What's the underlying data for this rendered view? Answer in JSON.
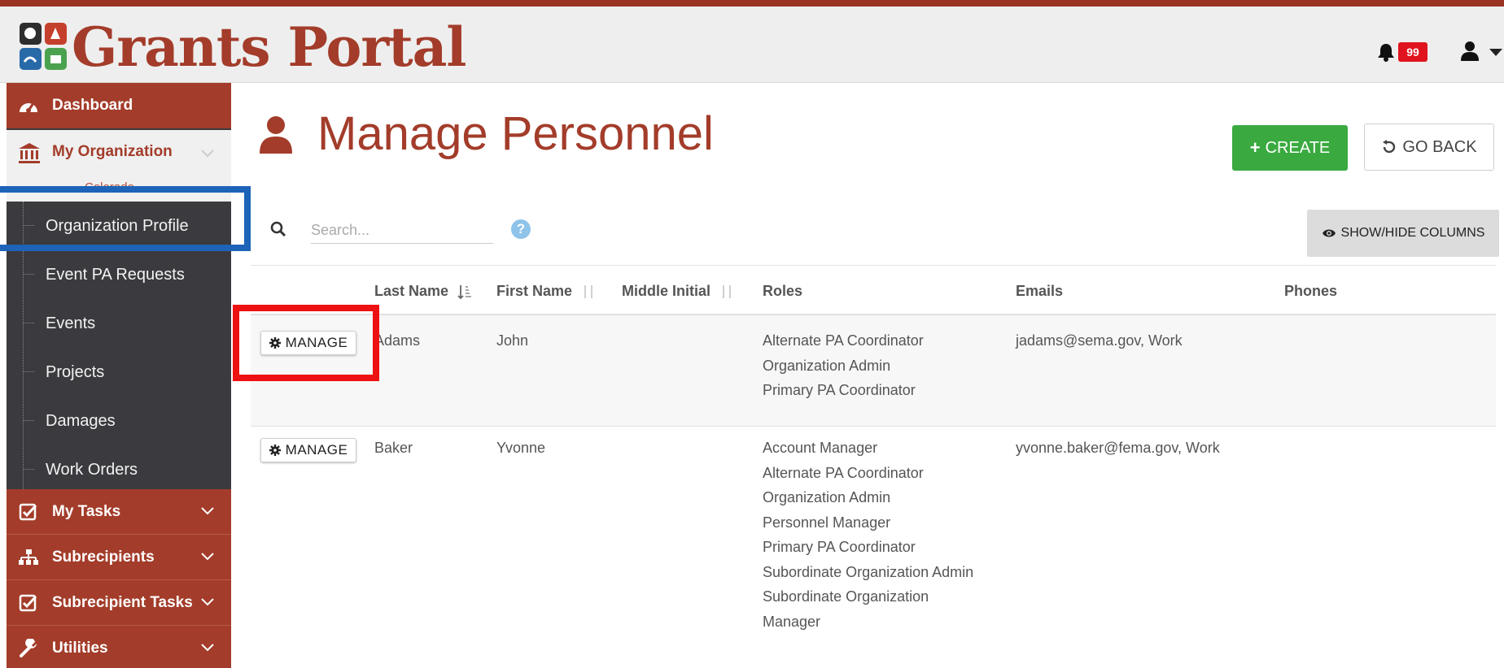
{
  "app": {
    "title": "Grants Portal",
    "notification_count": "99",
    "colors": {
      "brand": "#a33c2a",
      "sidebar_dark": "#3b3a3e",
      "create_green": "#3aaa40",
      "badge_red": "#e0141e"
    }
  },
  "sidebar": {
    "dashboard": "Dashboard",
    "my_organization": "My Organization",
    "organization_name": "Colorado",
    "sub_items": [
      "Organization Profile",
      "Event PA Requests",
      "Events",
      "Projects",
      "Damages",
      "Work Orders"
    ],
    "my_tasks": "My Tasks",
    "subrecipients": "Subrecipients",
    "subrecipient_tasks": "Subrecipient Tasks",
    "utilities": "Utilities"
  },
  "main": {
    "title": "Manage Personnel",
    "create_label": "CREATE",
    "back_label": "GO BACK",
    "search_placeholder": "Search...",
    "help_symbol": "?",
    "columns_label": "SHOW/HIDE COLUMNS",
    "headers": [
      "Last Name",
      "First Name",
      "Middle Initial",
      "Roles",
      "Emails",
      "Phones"
    ],
    "manage_label": "MANAGE",
    "rows": [
      {
        "last": "Adams",
        "first": "John",
        "middle": "",
        "roles": [
          "Alternate PA Coordinator",
          "Organization Admin",
          "Primary PA Coordinator"
        ],
        "email": "jadams@sema.gov, Work",
        "phone": ""
      },
      {
        "last": "Baker",
        "first": "Yvonne",
        "middle": "",
        "roles": [
          "Account Manager",
          "Alternate PA Coordinator",
          "Organization Admin",
          "Personnel Manager",
          "Primary PA Coordinator",
          "Subordinate Organization Admin",
          "Subordinate Organization",
          "Manager"
        ],
        "email": "yvonne.baker@fema.gov, Work",
        "phone": ""
      }
    ]
  },
  "icons": {
    "logo": "shield-logo-icon",
    "bell": "bell-icon",
    "user": "user-icon",
    "dashboard": "tachometer-icon",
    "organization": "bank-icon",
    "tasks": "check-square-icon",
    "subrecipients": "sitemap-icon",
    "utilities": "wrench-icon",
    "search": "search-icon",
    "create": "plus-icon",
    "back": "undo-icon",
    "columns": "eye-icon",
    "manage": "gear-icon"
  }
}
